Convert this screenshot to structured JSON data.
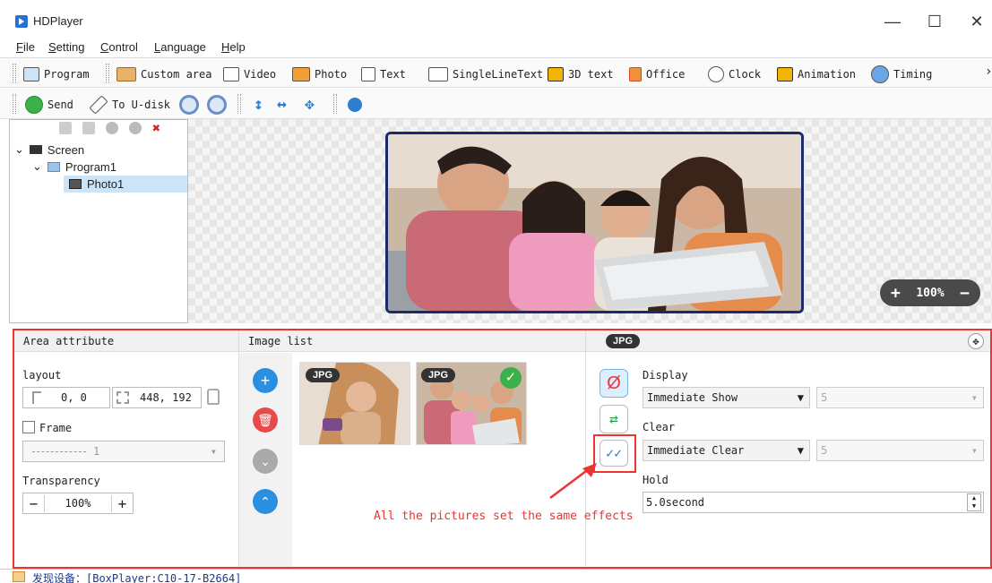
{
  "window": {
    "title": "HDPlayer",
    "minimize": "—",
    "maximize": "☐",
    "close": "✕"
  },
  "menu": [
    {
      "key": "F",
      "rest": "ile"
    },
    {
      "key": "S",
      "rest": "etting"
    },
    {
      "key": "C",
      "rest": "ontrol"
    },
    {
      "key": "L",
      "rest": "anguage"
    },
    {
      "key": "H",
      "rest": "elp"
    }
  ],
  "toolbar1": {
    "program": "Program",
    "custom_area": "Custom area",
    "video": "Video",
    "photo": "Photo",
    "text": "Text",
    "single_line_text": "SingleLineText",
    "text_3d": "3D text",
    "office": "Office",
    "clock": "Clock",
    "animation": "Animation",
    "timing": "Timing",
    "more": "›"
  },
  "toolbar2": {
    "send": "Send",
    "to_udisk": "To U-disk"
  },
  "tree": {
    "screen": "Screen",
    "program": "Program1",
    "photo": "Photo1"
  },
  "canvas": {
    "zoom": "100%",
    "zoom_in": "+",
    "zoom_out": "−"
  },
  "area_attribute": {
    "header": "Area attribute",
    "layout_label": "layout",
    "position": "0, 0",
    "size": "448, 192",
    "frame_label": "Frame",
    "frame_value": "1",
    "transparency_label": "Transparency",
    "transparency_value": "100%",
    "minus": "−",
    "plus": "+"
  },
  "image_list": {
    "header": "Image list",
    "images": [
      {
        "badge": "JPG"
      },
      {
        "badge": "JPG"
      }
    ]
  },
  "effects": {
    "header_badge": "JPG",
    "display_label": "Display",
    "display_value": "Immediate Show",
    "display_speed": "5",
    "clear_label": "Clear",
    "clear_value": "Immediate Clear",
    "clear_speed": "5",
    "hold_label": "Hold",
    "hold_value": "5.0second",
    "annotation": "All the pictures set the same effects"
  },
  "status": {
    "text": "发现设备：[BoxPlayer:C10-17-B2664]"
  },
  "colors": {
    "accent_red": "#e33333",
    "blue": "#2a8fe0"
  }
}
